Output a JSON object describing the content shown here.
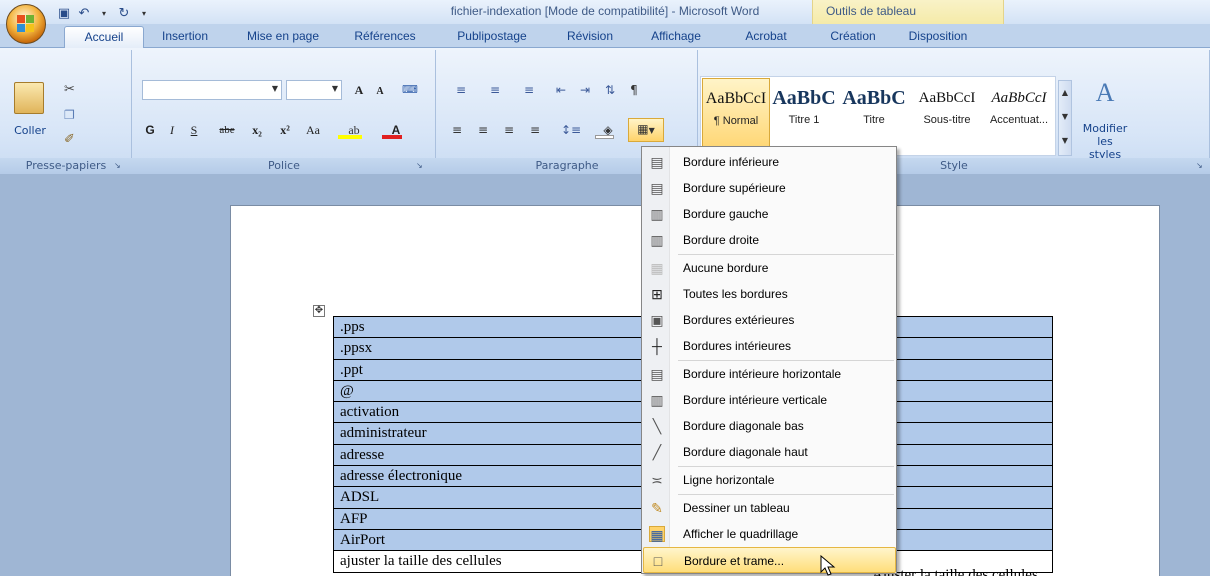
{
  "window": {
    "title": "fichier-indexation [Mode de compatibilité] - Microsoft Word",
    "context_group": "Outils de tableau"
  },
  "tabs": [
    {
      "label": "Accueil",
      "active": true
    },
    {
      "label": "Insertion"
    },
    {
      "label": "Mise en page"
    },
    {
      "label": "Références"
    },
    {
      "label": "Publipostage"
    },
    {
      "label": "Révision"
    },
    {
      "label": "Affichage"
    },
    {
      "label": "Acrobat"
    },
    {
      "label": "Création"
    },
    {
      "label": "Disposition"
    }
  ],
  "ribbon": {
    "clipboard": {
      "paste": "Coller",
      "label": "Presse-papiers"
    },
    "font": {
      "label": "Police",
      "bold": "G",
      "italic": "I",
      "underline": "S",
      "strike": "abe",
      "sub": "x₂",
      "sup": "x²",
      "case": "Aa",
      "grow": "A",
      "shrink": "A"
    },
    "paragraph": {
      "label": "Paragraphe"
    },
    "styles": {
      "label": "Style",
      "items": [
        {
          "preview": "AaBbCcI",
          "name": "¶ Normal"
        },
        {
          "preview": "AaBbC",
          "name": "Titre 1"
        },
        {
          "preview": "AaBbC",
          "name": "Titre"
        },
        {
          "preview": "AaBbCcI",
          "name": "Sous-titre"
        },
        {
          "preview": "AaBbCcI",
          "name": "Accentuat..."
        }
      ],
      "modify": "Modifier les styles"
    }
  },
  "table": {
    "rows": [
      ".pps",
      ".ppsx",
      ".ppt",
      "@",
      "activation",
      "administrateur",
      "adresse",
      "adresse électronique",
      "ADSL",
      "AFP",
      "AirPort",
      "ajuster la taille des cellules"
    ],
    "right_partial": "Ajuster la taille des cellules"
  },
  "border_menu": {
    "items": [
      {
        "label": "Bordure inférieure",
        "icon": "border-bottom-icon"
      },
      {
        "label": "Bordure supérieure",
        "icon": "border-top-icon"
      },
      {
        "label": "Bordure gauche",
        "icon": "border-left-icon"
      },
      {
        "label": "Bordure droite",
        "icon": "border-right-icon"
      },
      {
        "label": "Aucune bordure",
        "icon": "no-border-icon"
      },
      {
        "label": "Toutes les bordures",
        "icon": "all-borders-icon"
      },
      {
        "label": "Bordures extérieures",
        "icon": "outside-borders-icon"
      },
      {
        "label": "Bordures intérieures",
        "icon": "inside-borders-icon"
      },
      {
        "label": "Bordure intérieure horizontale",
        "icon": "inside-horizontal-border-icon"
      },
      {
        "label": "Bordure intérieure verticale",
        "icon": "inside-vertical-border-icon"
      },
      {
        "label": "Bordure diagonale bas",
        "icon": "diagonal-down-border-icon"
      },
      {
        "label": "Bordure diagonale haut",
        "icon": "diagonal-up-border-icon"
      },
      {
        "label": "Ligne horizontale",
        "icon": "horizontal-line-icon"
      },
      {
        "label": "Dessiner un tableau",
        "icon": "draw-table-icon"
      },
      {
        "label": "Afficher le quadrillage",
        "icon": "view-gridlines-icon"
      },
      {
        "label": "Bordure et trame...",
        "icon": "borders-shading-icon",
        "highlighted": true
      }
    ]
  },
  "colors": {
    "highlight_bg": "#ffde7a",
    "table_fill": "#b0c9ea",
    "ribbon": "#d7e5f7"
  }
}
